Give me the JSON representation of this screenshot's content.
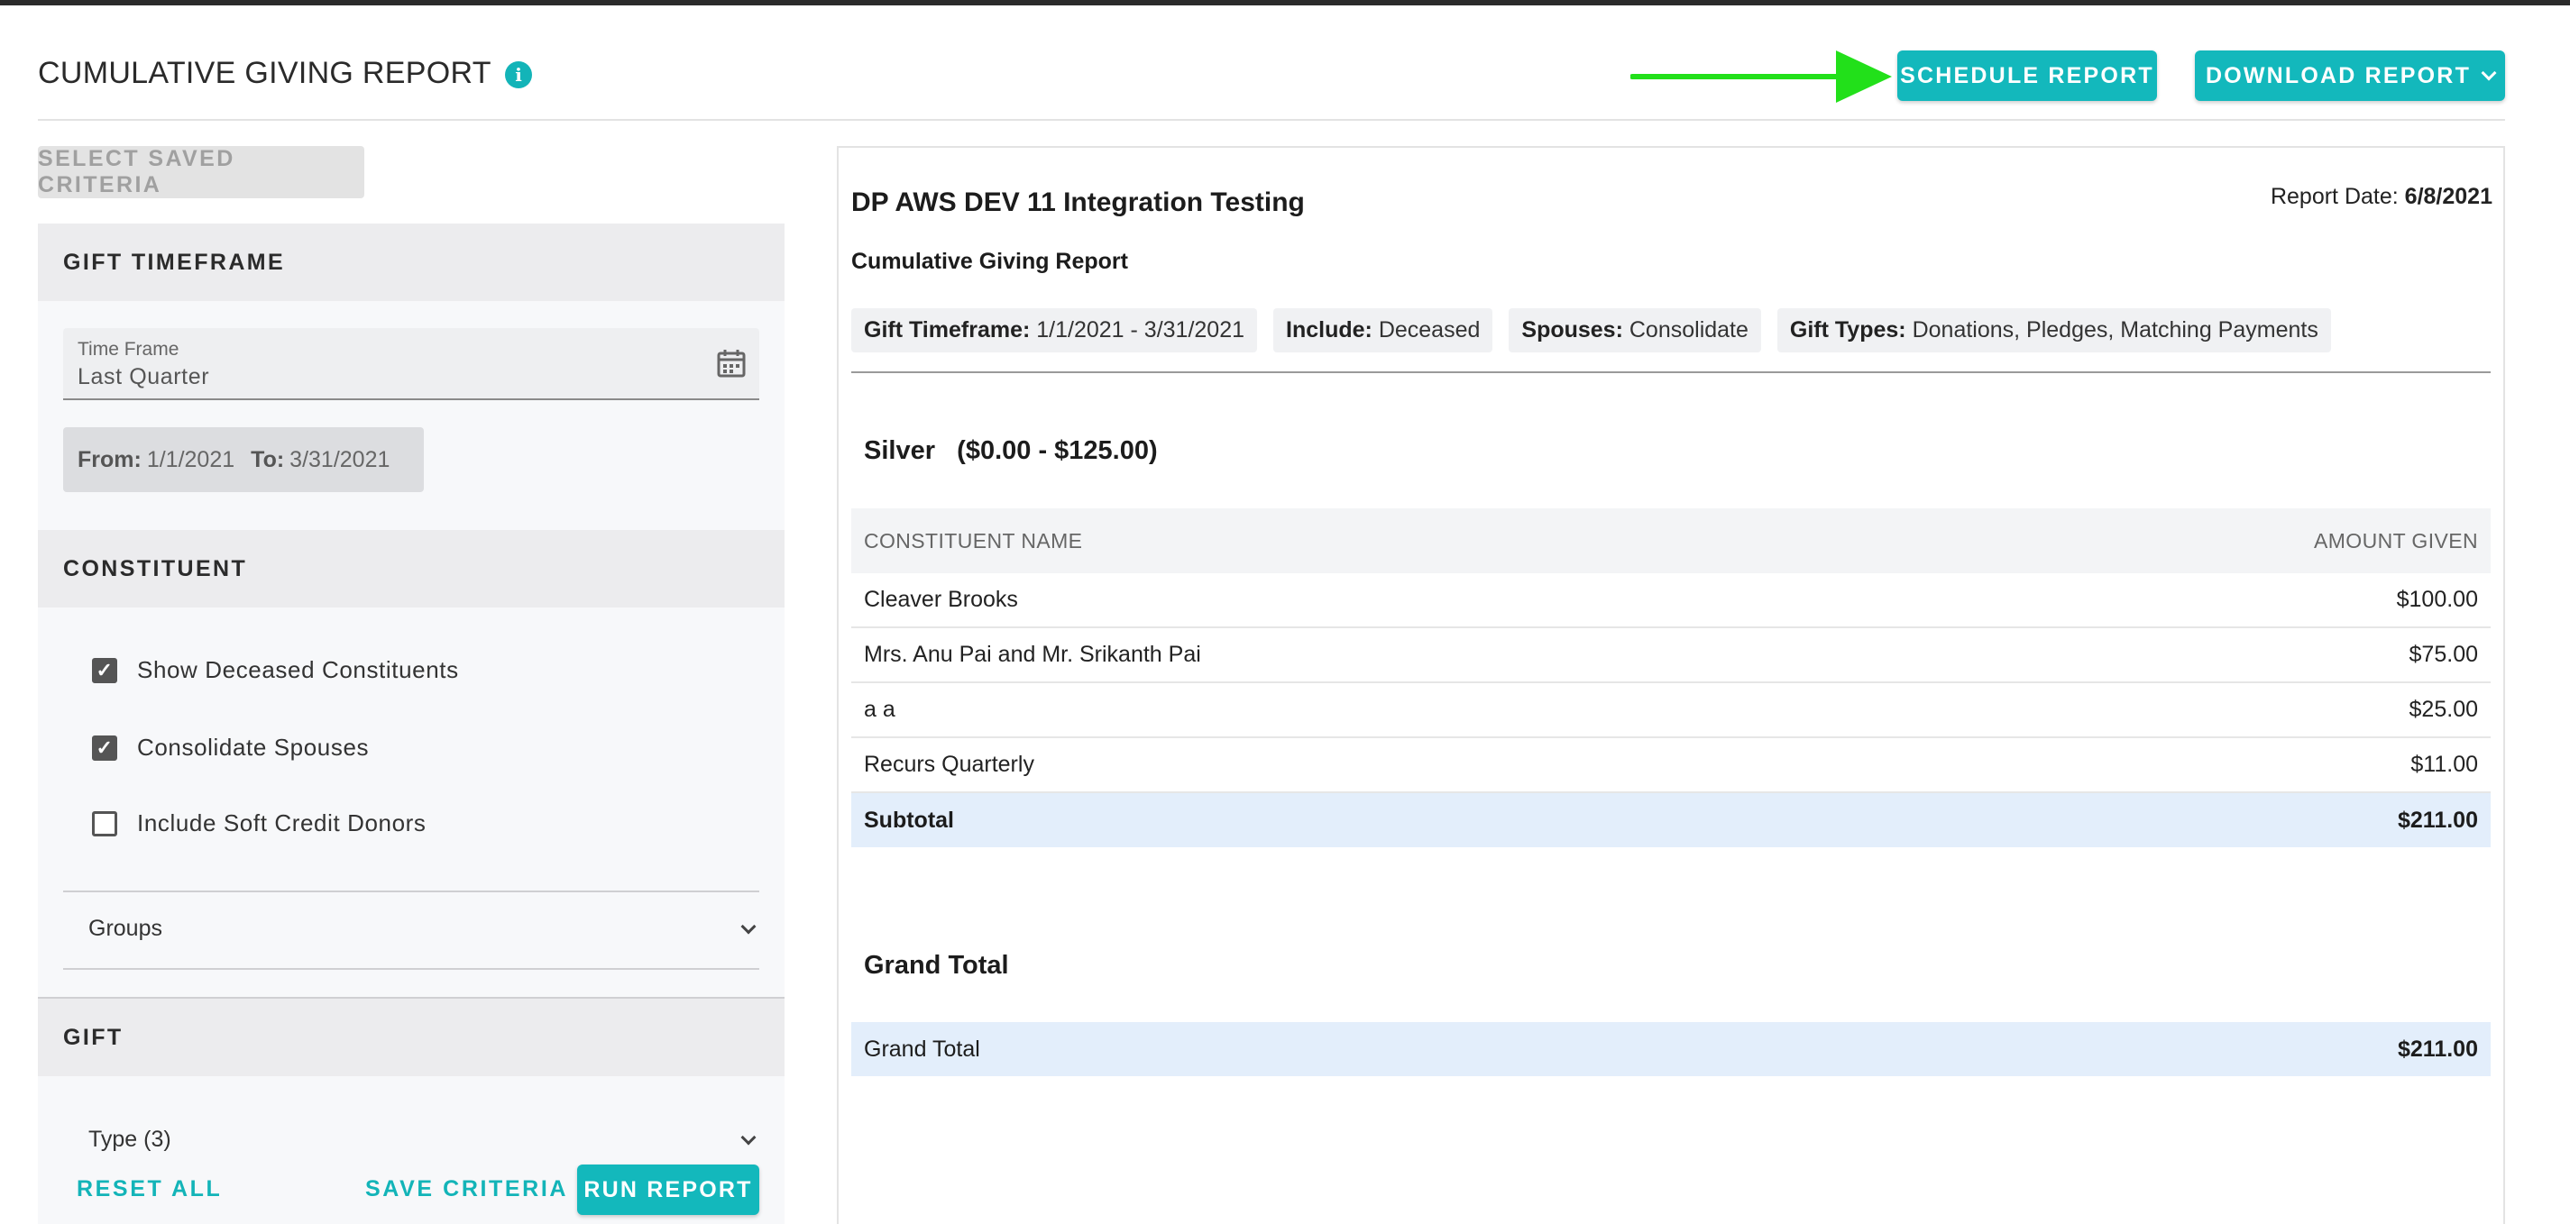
{
  "header": {
    "title": "CUMULATIVE GIVING REPORT",
    "info_icon_glyph": "i",
    "schedule_label": "SCHEDULE REPORT",
    "download_label": "DOWNLOAD REPORT",
    "accent_color": "#13b8bc",
    "arrow_color": "#22e01a"
  },
  "left": {
    "saved_criteria_label": "SELECT SAVED CRITERIA",
    "gift_timeframe": {
      "heading": "GIFT TIMEFRAME",
      "field_label": "Time Frame",
      "field_value": "Last Quarter",
      "from_label": "From:",
      "from_value": "1/1/2021",
      "to_label": "To:",
      "to_value": "3/31/2021"
    },
    "constituent": {
      "heading": "CONSTITUENT",
      "options": [
        {
          "label": "Show Deceased Constituents",
          "checked": true
        },
        {
          "label": "Consolidate Spouses",
          "checked": true
        },
        {
          "label": "Include Soft Credit Donors",
          "checked": false
        }
      ],
      "groups_label": "Groups"
    },
    "gift": {
      "heading": "GIFT",
      "type_label": "Type (3)"
    },
    "footer": {
      "reset_label": "RESET ALL",
      "save_label": "SAVE CRITERIA",
      "run_label": "RUN REPORT"
    }
  },
  "report": {
    "org_name": "DP AWS DEV 11 Integration Testing",
    "date_label": "Report Date:",
    "date_value": "6/8/2021",
    "subtitle": "Cumulative Giving Report",
    "filters": [
      {
        "key": "Gift Timeframe:",
        "value": "1/1/2021 - 3/31/2021"
      },
      {
        "key": "Include:",
        "value": "Deceased"
      },
      {
        "key": "Spouses:",
        "value": "Consolidate"
      },
      {
        "key": "Gift Types:",
        "value": "Donations, Pledges, Matching Payments"
      }
    ],
    "tier_title": "Silver   ($0.00 - $125.00)",
    "columns": {
      "name": "CONSTITUENT NAME",
      "amount": "AMOUNT GIVEN"
    },
    "rows": [
      {
        "name": "Cleaver Brooks",
        "amount": "$100.00"
      },
      {
        "name": "Mrs. Anu Pai and Mr. Srikanth Pai",
        "amount": "$75.00"
      },
      {
        "name": "a a",
        "amount": "$25.00"
      },
      {
        "name": "Recurs Quarterly",
        "amount": "$11.00"
      }
    ],
    "subtotal_label": "Subtotal",
    "subtotal_value": "$211.00",
    "grand_total_title": "Grand Total",
    "grand_total_label": "Grand Total",
    "grand_total_value": "$211.00"
  }
}
